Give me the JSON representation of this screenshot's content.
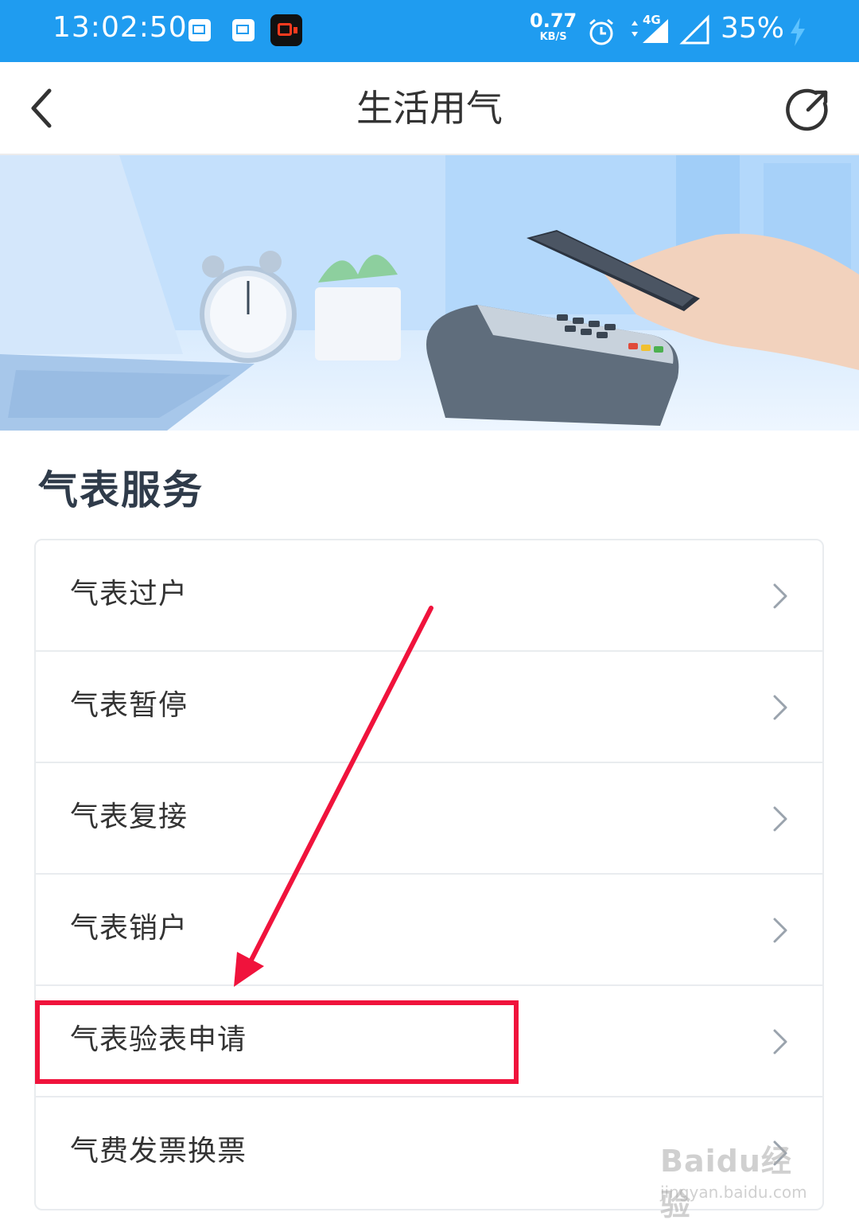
{
  "status_bar": {
    "time": "13:02:50",
    "net_speed": "0.77",
    "net_unit": "KB/S",
    "network_type": "4G",
    "battery": "35%",
    "icons": [
      "mail-notification-icon",
      "mail-notification-icon",
      "screen-record-icon",
      "alarm-icon",
      "signal-icon",
      "signal-icon",
      "charging-icon"
    ]
  },
  "header": {
    "title": "生活用气",
    "back_icon": "chevron-left-icon",
    "share_icon": "share-icon"
  },
  "section": {
    "title": "气表服务",
    "items": [
      {
        "label": "气表过户"
      },
      {
        "label": "气表暂停"
      },
      {
        "label": "气表复接"
      },
      {
        "label": "气表销户"
      },
      {
        "label": "气表验表申请"
      },
      {
        "label": "气费发票换票"
      }
    ]
  },
  "watermark": {
    "brand": "Baidu经验",
    "url": "jingyan.baidu.com"
  },
  "colors": {
    "status_bar": "#1f9cf0",
    "annotation": "#f0133c",
    "section_title": "#2f3b4a"
  }
}
